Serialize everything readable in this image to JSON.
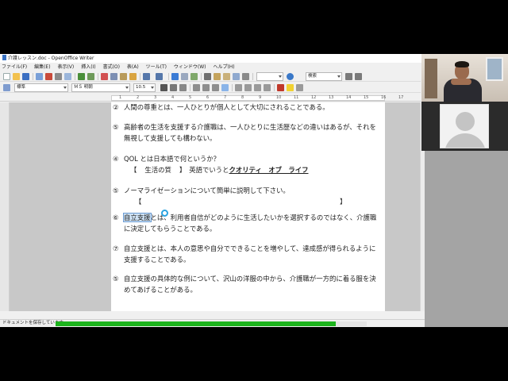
{
  "window": {
    "title": "介護レッスン.doc - OpenOffice Writer"
  },
  "menu": [
    "ファイル(F)",
    "編集(E)",
    "表示(V)",
    "挿入(I)",
    "書式(O)",
    "表(A)",
    "ツール(T)",
    "ウィンドウ(W)",
    "ヘルプ(H)"
  ],
  "toolbar": {
    "paragraph_style": "標準",
    "font_name": "ＭＳ 明朝",
    "font_size": "10.5",
    "search_placeholder": "検索"
  },
  "ruler": {
    "numbers": [
      "1",
      "2",
      "3",
      "4",
      "5",
      "6",
      "7",
      "8",
      "9",
      "10",
      "11",
      "12",
      "13",
      "14",
      "15",
      "16",
      "17"
    ]
  },
  "document": {
    "questions": [
      {
        "num": "②",
        "lines": [
          "人間の尊重とは、一人ひとりが個人として大切にされることである。"
        ]
      },
      {
        "num": "⑤",
        "lines": [
          "高齢者の生活を支援する介護職は、一人ひとりに生活歴などの違いはあるが、それを",
          "無視して支援しても構わない。"
        ]
      },
      {
        "num": "④",
        "lines": [
          "QOL とは日本語で何というか？"
        ],
        "answer": {
          "open": "【",
          "answer_text": "生活の質",
          "close": "】",
          "label": "英語でいうと",
          "english": "クオリティ　オブ　ライフ"
        }
      },
      {
        "num": "⑤",
        "lines": [
          "ノーマライゼーションについて簡単に説明して下さい。"
        ],
        "answer_blank": {
          "open": "【",
          "close": "】"
        }
      },
      {
        "num": "⑥",
        "highlighted": "自立支援",
        "lines": [
          "とは、利用者自信がどのように生活したいかを選択するのではなく、介護職",
          "に決定してもらうことである。"
        ]
      },
      {
        "num": "⑦",
        "lines": [
          "自立支援とは、本人の意思や自分でできることを増やして、達成感が得られるように",
          "支援することである。"
        ]
      },
      {
        "num": "⑤",
        "lines": [
          "自立支援の具体的な例について、沢山の洋服の中から、介護職が一方的に着る服を決",
          "めてあげることがある。"
        ]
      }
    ]
  },
  "status": {
    "message": "ドキュメントを保存しています...",
    "progress_fraction": 0.9
  }
}
